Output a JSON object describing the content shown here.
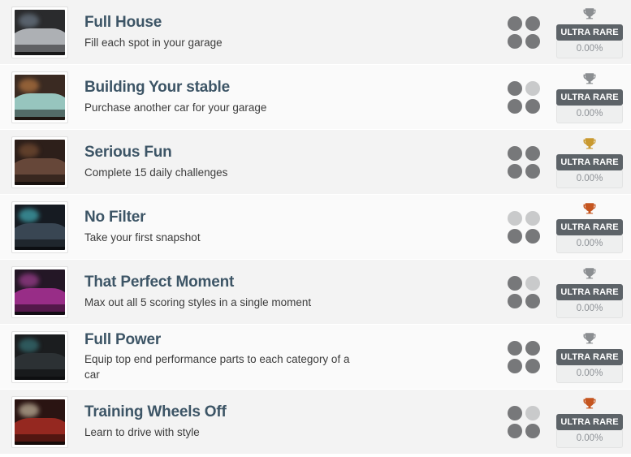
{
  "list": {
    "rarity_percent_all": "0.00%",
    "rarity_label_all": "ULTRA RARE",
    "rows": [
      {
        "name": "Full House",
        "description": "Fill each spot in your garage",
        "rarity_label": "ULTRA RARE",
        "rarity_percent": "0.00%",
        "trophy_type": "silver-trophy-icon",
        "trophy_color": "#8b8e91",
        "dots": [
          "on",
          "on",
          "on",
          "on"
        ],
        "thumb": {
          "base": "#2a2b2d",
          "accent": "#b9bcc0",
          "glow": "#7f8fa0"
        }
      },
      {
        "name": "Building Your stable",
        "description": "Purchase another car for your garage",
        "rarity_label": "ULTRA RARE",
        "rarity_percent": "0.00%",
        "trophy_type": "silver-trophy-icon",
        "trophy_color": "#8b8e91",
        "dots": [
          "on",
          "off",
          "on",
          "on"
        ],
        "thumb": {
          "base": "#3a2a22",
          "accent": "#9fd3cc",
          "glow": "#d98c4a"
        }
      },
      {
        "name": "Serious Fun",
        "description": "Complete 15 daily challenges",
        "rarity_label": "ULTRA RARE",
        "rarity_percent": "0.00%",
        "trophy_type": "gold-trophy-icon",
        "trophy_color": "#c9992f",
        "dots": [
          "on",
          "on",
          "on",
          "on"
        ],
        "thumb": {
          "base": "#2d1f1a",
          "accent": "#6b4b3c",
          "glow": "#8a5a3a"
        }
      },
      {
        "name": "No Filter",
        "description": "Take your first snapshot",
        "rarity_label": "ULTRA RARE",
        "rarity_percent": "0.00%",
        "trophy_type": "bronze-trophy-icon",
        "trophy_color": "#c5551f",
        "dots": [
          "off",
          "off",
          "on",
          "on"
        ],
        "thumb": {
          "base": "#161b22",
          "accent": "#3d4a58",
          "glow": "#4fd6e0"
        }
      },
      {
        "name": "That Perfect Moment",
        "description": "Max out all 5 scoring styles in a single moment",
        "rarity_label": "ULTRA RARE",
        "rarity_percent": "0.00%",
        "trophy_type": "silver-trophy-icon",
        "trophy_color": "#8b8e91",
        "dots": [
          "on",
          "off",
          "on",
          "on"
        ],
        "thumb": {
          "base": "#241726",
          "accent": "#a3308f",
          "glow": "#c44bb0"
        }
      },
      {
        "name": "Full Power",
        "description": "Equip top end performance parts to each category of a car",
        "rarity_label": "ULTRA RARE",
        "rarity_percent": "0.00%",
        "trophy_type": "silver-trophy-icon",
        "trophy_color": "#8b8e91",
        "dots": [
          "on",
          "on",
          "on",
          "on"
        ],
        "thumb": {
          "base": "#1b1d1f",
          "accent": "#2e3336",
          "glow": "#3f8a8f"
        }
      },
      {
        "name": "Training Wheels Off",
        "description": "Learn to drive with style",
        "rarity_label": "ULTRA RARE",
        "rarity_percent": "0.00%",
        "trophy_type": "bronze-trophy-icon",
        "trophy_color": "#c5551f",
        "dots": [
          "on",
          "off",
          "on",
          "on"
        ],
        "thumb": {
          "base": "#2a1412",
          "accent": "#9e2a22",
          "glow": "#f0e6c8"
        }
      }
    ]
  }
}
